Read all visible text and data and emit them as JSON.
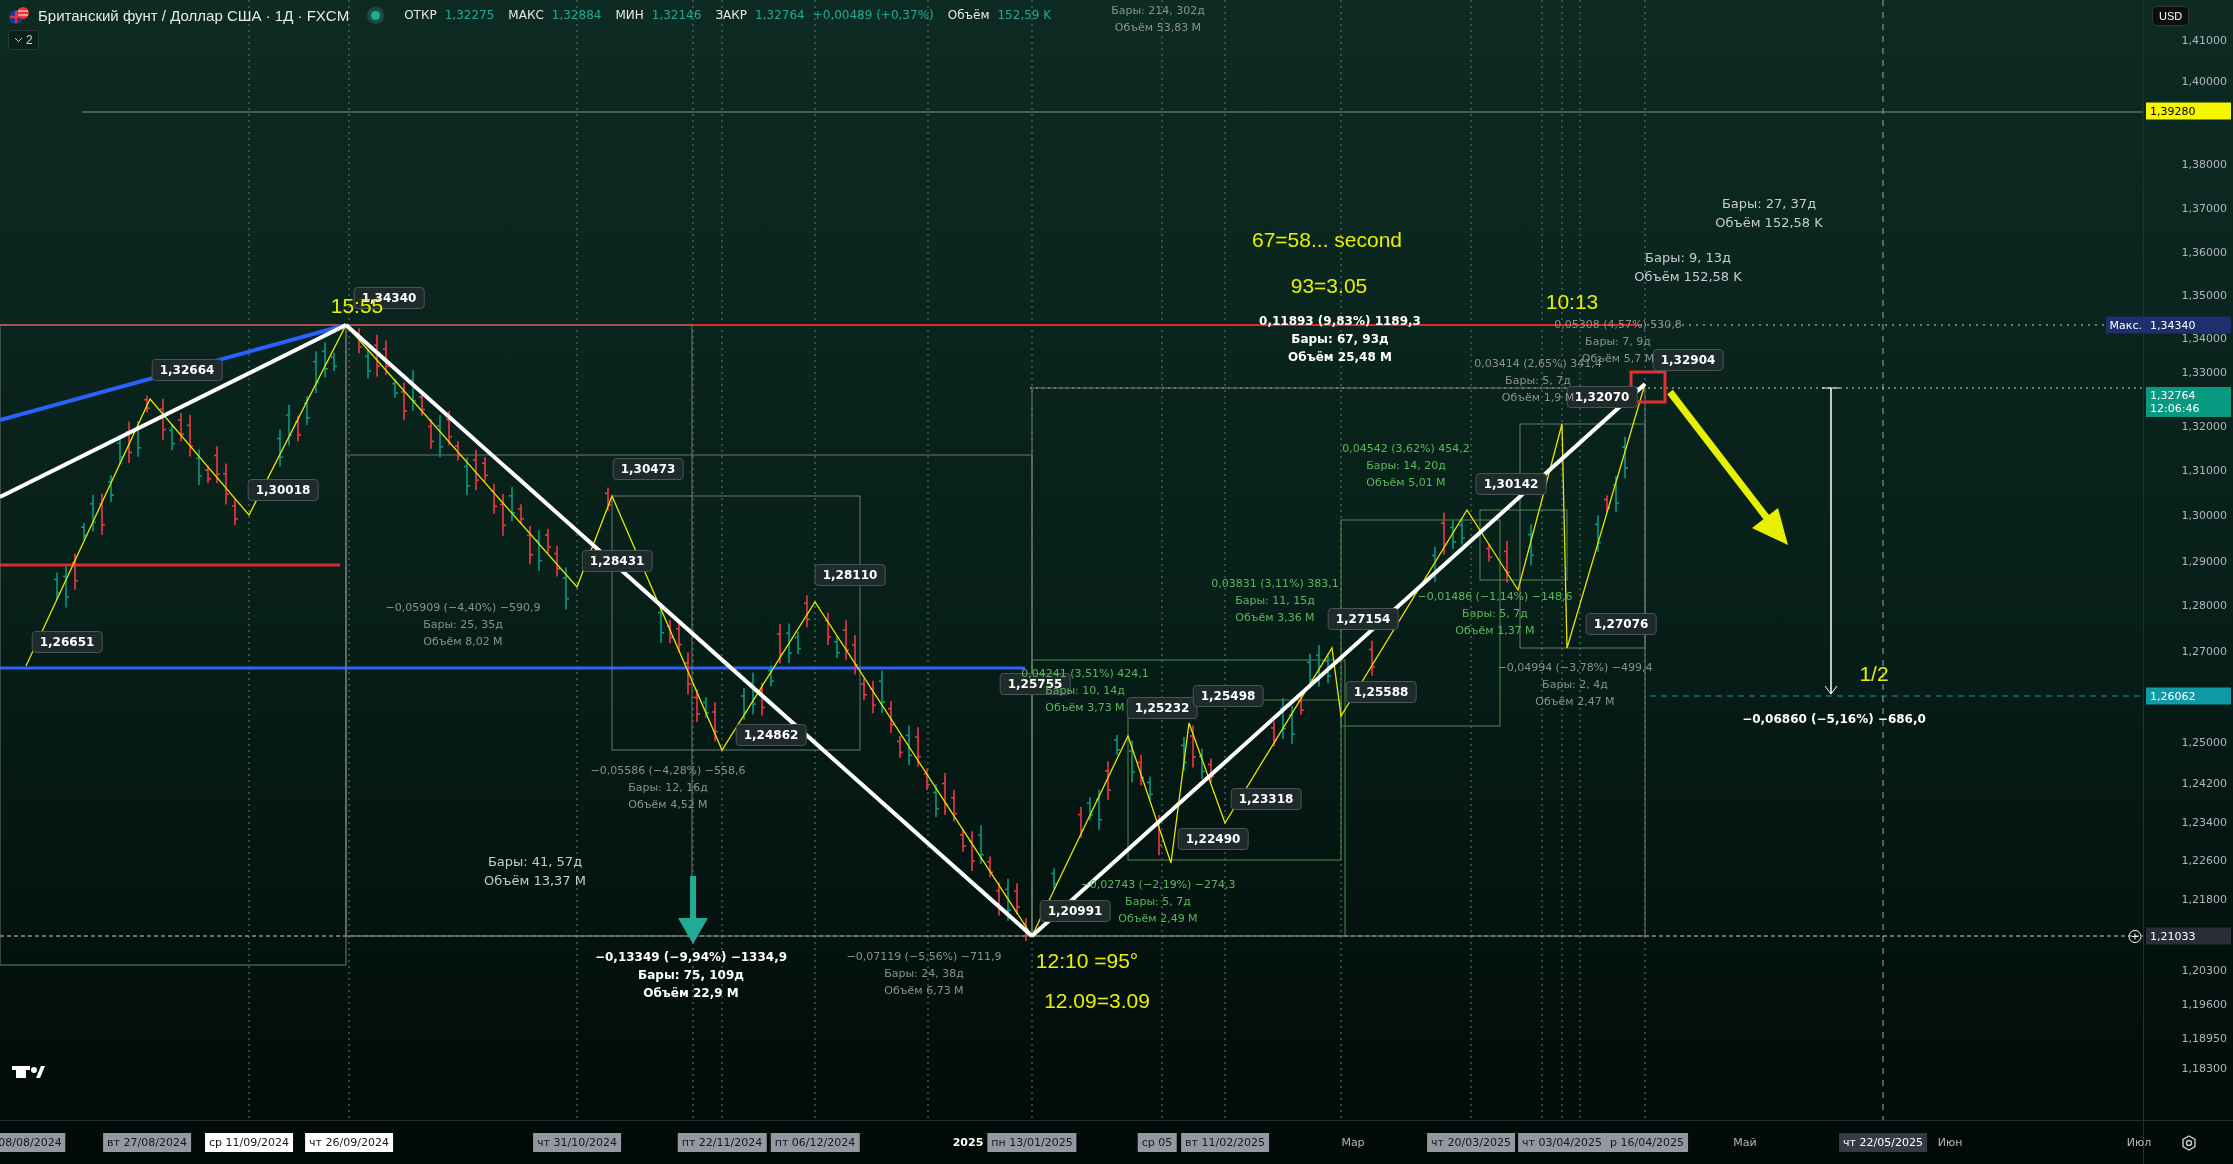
{
  "header": {
    "symbol": "Британский фунт / Доллар США · 1Д · FXCM",
    "market_open": true,
    "quotes": [
      {
        "label": "ОТКР",
        "value": "1,32275"
      },
      {
        "label": "МАКС",
        "value": "1,32884"
      },
      {
        "label": "МИН",
        "value": "1,32146"
      },
      {
        "label": "ЗАКР",
        "value": "1,32764"
      }
    ],
    "change": "+0,00489 (+0,37%)",
    "volume_label": "Объём",
    "volume": "152,59 K",
    "indicators_count": "2"
  },
  "currency": "USD",
  "price_axis": {
    "ticks": [
      "1,41000",
      "1,40000",
      "1,38000",
      "1,37000",
      "1,36000",
      "1,35000",
      "1,34000",
      "1,33000",
      "1,32000",
      "1,31000",
      "1,30000",
      "1,29000",
      "1,28000",
      "1,27000",
      "1,25000",
      "1,24200",
      "1,23400",
      "1,22600",
      "1,21800",
      "1,20300",
      "1,19600",
      "1,18950",
      "1,18300"
    ],
    "badges": [
      {
        "kind": "alert",
        "value": "1,39280"
      },
      {
        "kind": "high",
        "label": "Макс.",
        "value": "1,34340"
      },
      {
        "kind": "last",
        "value": "1,32764",
        "countdown": "12:06:46"
      },
      {
        "kind": "target",
        "value": "1,26062"
      },
      {
        "kind": "low",
        "value": "1,21033"
      }
    ]
  },
  "pivot_labels": [
    "1,34340",
    "1,32664",
    "1,30018",
    "1,30473",
    "1,28431",
    "1,28110",
    "1,24862",
    "1,26651",
    "1,25755",
    "1,25232",
    "1,25498",
    "1,22490",
    "1,23318",
    "1,20991",
    "1,27154",
    "1,25588",
    "1,30142",
    "1,32070",
    "1,27076",
    "1,32904"
  ],
  "annotations": [
    {
      "kind": "grey",
      "lines": [
        "Бары: 214, 302д",
        "Объём 53,83 M"
      ]
    },
    {
      "kind": "yellow",
      "lines": [
        "15:55"
      ]
    },
    {
      "kind": "yellow",
      "lines": [
        "67=58... second"
      ]
    },
    {
      "kind": "yellow",
      "lines": [
        "93=3.05"
      ]
    },
    {
      "kind": "white",
      "lines": [
        "0,11893 (9,83%) 1189,3",
        "Бары: 67, 93д",
        "Объём 25,48 M"
      ]
    },
    {
      "kind": "yellow",
      "lines": [
        "10:13"
      ]
    },
    {
      "kind": "grey",
      "lines": [
        "0,05308 (4,57%) 530,8",
        "Бары: 7, 9д",
        "Объём 5,7 M"
      ]
    },
    {
      "kind": "info",
      "lines": [
        "Бары: 27, 37д",
        "Объём 152,58 K"
      ]
    },
    {
      "kind": "info",
      "lines": [
        "Бары: 9, 13д",
        "Объём 152,58 K"
      ]
    },
    {
      "kind": "grey",
      "lines": [
        "0,03414 (2,65%) 341,4",
        "Бары: 5, 7д",
        "Объём 1,9 M"
      ]
    },
    {
      "kind": "green",
      "lines": [
        "0,04542 (3,62%) 454,2",
        "Бары: 14, 20д",
        "Объём 5,01 M"
      ]
    },
    {
      "kind": "grey",
      "lines": [
        "−0,05909 (−4,40%) −590,9",
        "Бары: 25, 35д",
        "Объём 8,02 M"
      ]
    },
    {
      "kind": "green",
      "lines": [
        "0,03831 (3,11%) 383,1",
        "Бары: 11, 15д",
        "Объём 3,36 M"
      ]
    },
    {
      "kind": "green",
      "lines": [
        "−0,01486 (−1,14%) −148,6",
        "Бары: 5, 7д",
        "Объём 1,37 M"
      ]
    },
    {
      "kind": "grey",
      "lines": [
        "−0,04994 (−3,78%) −499,4",
        "Бары: 2, 4д",
        "Объём 2,47 M"
      ]
    },
    {
      "kind": "green",
      "lines": [
        "0,04241 (3,51%) 424,1",
        "Бары: 10, 14д",
        "Объём 3,73 M"
      ]
    },
    {
      "kind": "yellow",
      "lines": [
        "1/2"
      ]
    },
    {
      "kind": "white",
      "lines": [
        "−0,06860 (−5,16%) −686,0"
      ]
    },
    {
      "kind": "grey",
      "lines": [
        "−0,05586 (−4,28%) −558,6",
        "Бары: 12, 16д",
        "Объём 4,52 M"
      ]
    },
    {
      "kind": "info",
      "lines": [
        "Бары: 41, 57д",
        "Объём 13,37 M"
      ]
    },
    {
      "kind": "green",
      "lines": [
        "−0,02743 (−2,19%) −274,3",
        "Бары: 5, 7д",
        "Объём 2,49 M"
      ]
    },
    {
      "kind": "white",
      "lines": [
        "−0,13349 (−9,94%) −1334,9",
        "Бары: 75, 109д",
        "Объём 22,9 M"
      ]
    },
    {
      "kind": "grey",
      "lines": [
        "−0,07119 (−5,56%) −711,9",
        "Бары: 24, 38д",
        "Объём 6,73 M"
      ]
    },
    {
      "kind": "yellow",
      "lines": [
        "12:10 =95°"
      ]
    },
    {
      "kind": "yellow",
      "lines": [
        "12.09=3.09"
      ]
    }
  ],
  "time_axis": [
    {
      "label": "08/08/2024",
      "kind": "marker"
    },
    {
      "label": "вт 27/08/2024",
      "kind": "marker"
    },
    {
      "label": "ср 11/09/2024",
      "kind": "selected"
    },
    {
      "label": "чт 26/09/2024",
      "kind": "selected"
    },
    {
      "label": "чт 31/10/2024",
      "kind": "marker"
    },
    {
      "label": "пт 22/11/2024",
      "kind": "marker"
    },
    {
      "label": "пт 06/12/2024",
      "kind": "marker"
    },
    {
      "label": "2025",
      "kind": "year"
    },
    {
      "label": "пн 13/01/2025",
      "kind": "marker"
    },
    {
      "label": "ср 05",
      "kind": "marker"
    },
    {
      "label": "вт 11/02/2025",
      "kind": "marker"
    },
    {
      "label": "Мар",
      "kind": "plain"
    },
    {
      "label": "чт 20/03/2025",
      "kind": "marker"
    },
    {
      "label": "чт 03/04/2025",
      "kind": "marker"
    },
    {
      "label": "р 16/04/2025",
      "kind": "marker"
    },
    {
      "label": "Май",
      "kind": "plain"
    },
    {
      "label": "чт 22/05/2025",
      "kind": "cursor"
    },
    {
      "label": "Июн",
      "kind": "plain"
    },
    {
      "label": "Июл",
      "kind": "plain"
    }
  ]
}
